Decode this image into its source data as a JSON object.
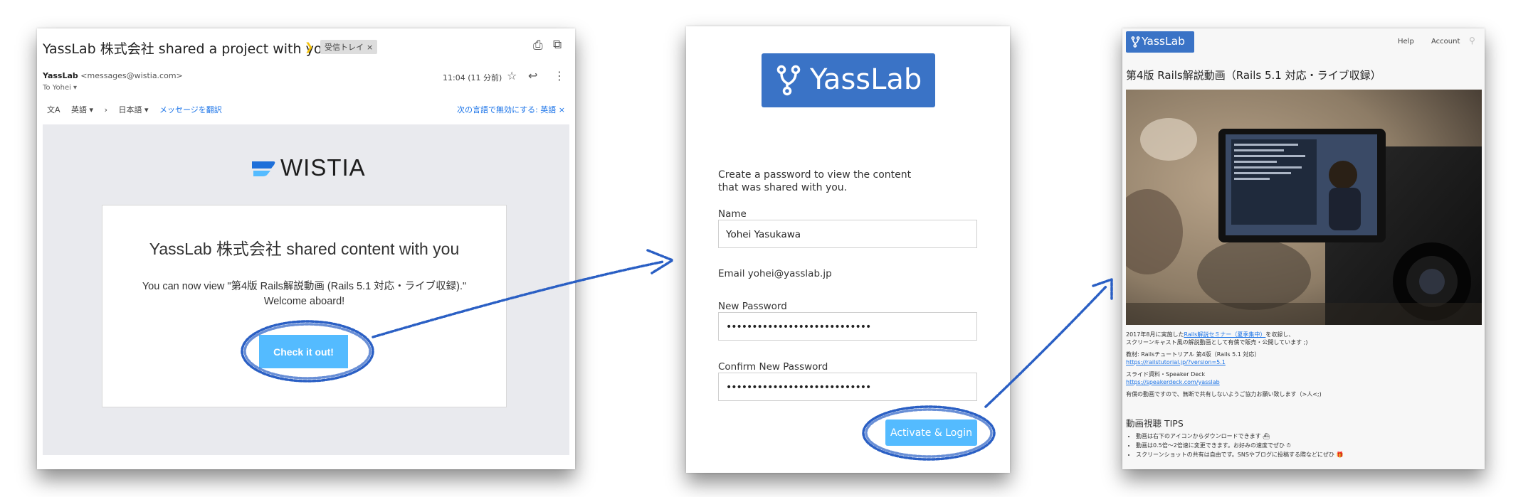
{
  "email": {
    "subject": "YassLab 株式会社 shared a project with you",
    "label": "受信トレイ",
    "label_close": "×",
    "sender_name": "YassLab",
    "sender_email": "<messages@wistia.com>",
    "to": "To Yohei ▾",
    "time": "11:04 (11 分前)",
    "translate": {
      "from_lang": "英語 ▾",
      "arrow": "›",
      "to_lang": "日本語 ▾",
      "translate_link": "メッセージを翻訳",
      "disable": "次の言語で無効にする: 英語  ×"
    },
    "wistia_brand": "WISTIA",
    "card_title": "YassLab 株式会社 shared content with you",
    "card_text": "You can now view \"第4版 Rails解説動画 (Rails 5.1 対応・ライブ収録).\" Welcome aboard!",
    "button": "Check it out!"
  },
  "login": {
    "logo_text": "YassLab",
    "intro": "Create a password to view the content that was shared with you.",
    "name_label": "Name",
    "name_value": "Yohei Yasukawa",
    "email_text": "Email yohei@yasslab.jp",
    "password_label": "New Password",
    "password_value": "••••••••••••••••••••••••••••",
    "confirm_label": "Confirm New Password",
    "confirm_value": "••••••••••••••••••••••••••••",
    "button": "Activate & Login"
  },
  "site": {
    "logo_text": "YassLab",
    "nav": [
      "Help",
      "Account"
    ],
    "title": "第4版 Rails解説動画（Rails 5.1 対応・ライブ収録）",
    "desc": {
      "line1_a": "2017年8月に実施した",
      "line1_link": "Rails解説セミナー（夏季集中）",
      "line1_b": "を収録し、",
      "line2": "スクリーンキャスト風の解説動画として有償で販売・公開しています ;)",
      "text_label": "教材: Railsチュートリアル 第4版（Rails 5.1 対応）",
      "text_link": "https://railstutorial.jp/?version=5.1",
      "slide_label": "スライド資料・Speaker Deck",
      "slide_link": "https://speakerdeck.com/yasslab",
      "note": "有償の動画ですので、無断で共有しないようご協力お願い致します（>人<;)"
    },
    "tips_heading": "動画視聴 TIPS",
    "tips": [
      "動画は右下のアイコンからダウンロードできます ⛴",
      "動画は0.5倍〜2倍速に変更できます。お好みの速度でぜひ ⏱",
      "スクリーンショットの共有は自由です。SNSやブログに投稿する際などにぜひ 🎁"
    ]
  },
  "colors": {
    "button_blue": "#54bbff",
    "brand_blue": "#3a73c6",
    "annotation_blue": "#2a5fc4",
    "link_blue": "#1a73e8"
  }
}
